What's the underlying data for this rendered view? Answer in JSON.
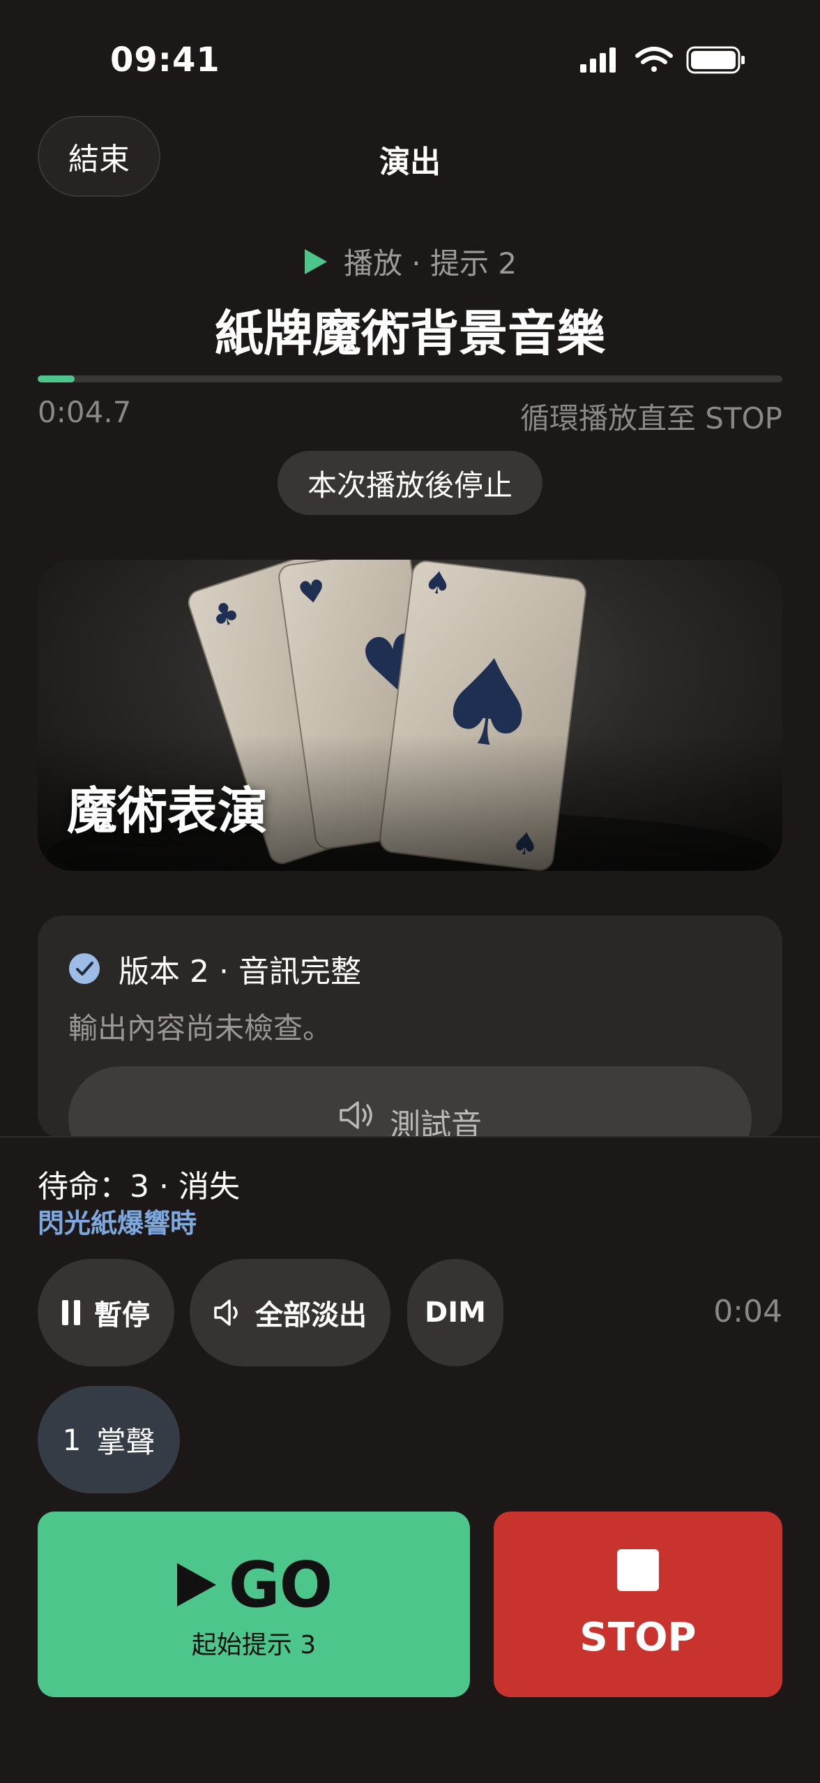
{
  "status_bar": {
    "time": "09:41"
  },
  "nav": {
    "end_label": "結束",
    "title": "演出"
  },
  "now_playing": {
    "state": "播放 · 提示 2",
    "track_title": "紙牌魔術背景音樂",
    "progress": 0.05,
    "elapsed": "0:04.7",
    "loop_note": "循環播放直至 STOP",
    "stop_after_label": "本次播放後停止"
  },
  "artwork": {
    "title": "魔術表演"
  },
  "info_card": {
    "version": "版本 2 · 音訊完整",
    "output_note": "輸出內容尚未檢查。",
    "test_tone_label": "測試音"
  },
  "panel": {
    "standby": "待命：3 · 消失",
    "trigger": "閃光紙爆響時",
    "pause_label": "暫停",
    "fadeout_label": "全部淡出",
    "dim_label": "DIM",
    "time": "0:04",
    "applause_number": "1",
    "applause_label": "掌聲",
    "go_label": "GO",
    "go_sub": "起始提示 3",
    "stop_label": "STOP"
  },
  "colors": {
    "background": "#1b1817",
    "accent_green": "#4cc68b",
    "stop_red": "#c8342d",
    "link_blue": "#7ea9e0"
  },
  "icons": [
    "signal-icon",
    "wifi-icon",
    "battery-icon",
    "play-icon",
    "check-circle-icon",
    "speaker-icon",
    "pause-icon",
    "stop-icon"
  ]
}
